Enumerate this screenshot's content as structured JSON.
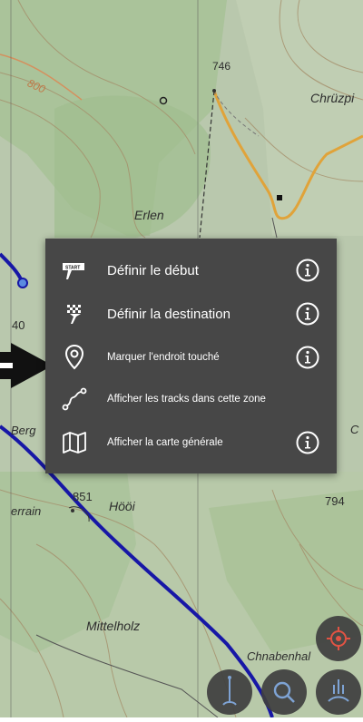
{
  "map": {
    "labels": {
      "elev_746": "746",
      "elev_800": "800",
      "chruzp": "Chrüzpi",
      "erlen": "Erlen",
      "elev_40": "40",
      "berg": "Berg",
      "c_right": "C",
      "elev_851": "851",
      "hooi": "Hööi",
      "terrain": "errain",
      "elev_794": "794",
      "mittelholz": "Mittelholz",
      "chnabenhalde": "Chnabenhal"
    }
  },
  "context_menu": {
    "items": [
      {
        "label": "Définir le début",
        "icon": "start-flag-icon",
        "has_info": true
      },
      {
        "label": "Définir la destination",
        "icon": "finish-flag-icon",
        "has_info": true
      },
      {
        "label": "Marquer l'endroit touché",
        "icon": "map-pin-icon",
        "has_info": true
      },
      {
        "label": "Afficher les tracks dans cette zone",
        "icon": "tracks-icon",
        "has_info": false
      },
      {
        "label": "Afficher la carte générale",
        "icon": "map-icon",
        "has_info": true
      }
    ],
    "start_badge": "START"
  },
  "colors": {
    "menu_bg": "#474747",
    "map_green": "#a9c597",
    "track_blue": "#1717a6",
    "road_orange": "#e0a33a"
  }
}
